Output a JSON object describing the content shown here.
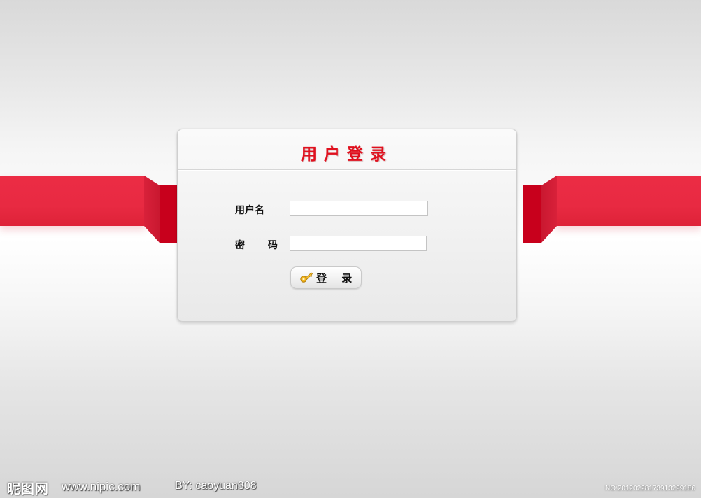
{
  "login": {
    "title": "用户登录",
    "username_label": "用户名",
    "username_value": "",
    "password_label": "密 码",
    "password_value": "",
    "submit_label": "登 录"
  },
  "icons": {
    "submit_icon": "key-icon"
  },
  "watermark": {
    "logo": "昵图网",
    "site": "www.nipic.com",
    "author": "BY: caoyuan308",
    "number": "NO:20120228173913299186"
  },
  "colors": {
    "accent_red": "#e82a42",
    "title_red": "#e0101e"
  }
}
